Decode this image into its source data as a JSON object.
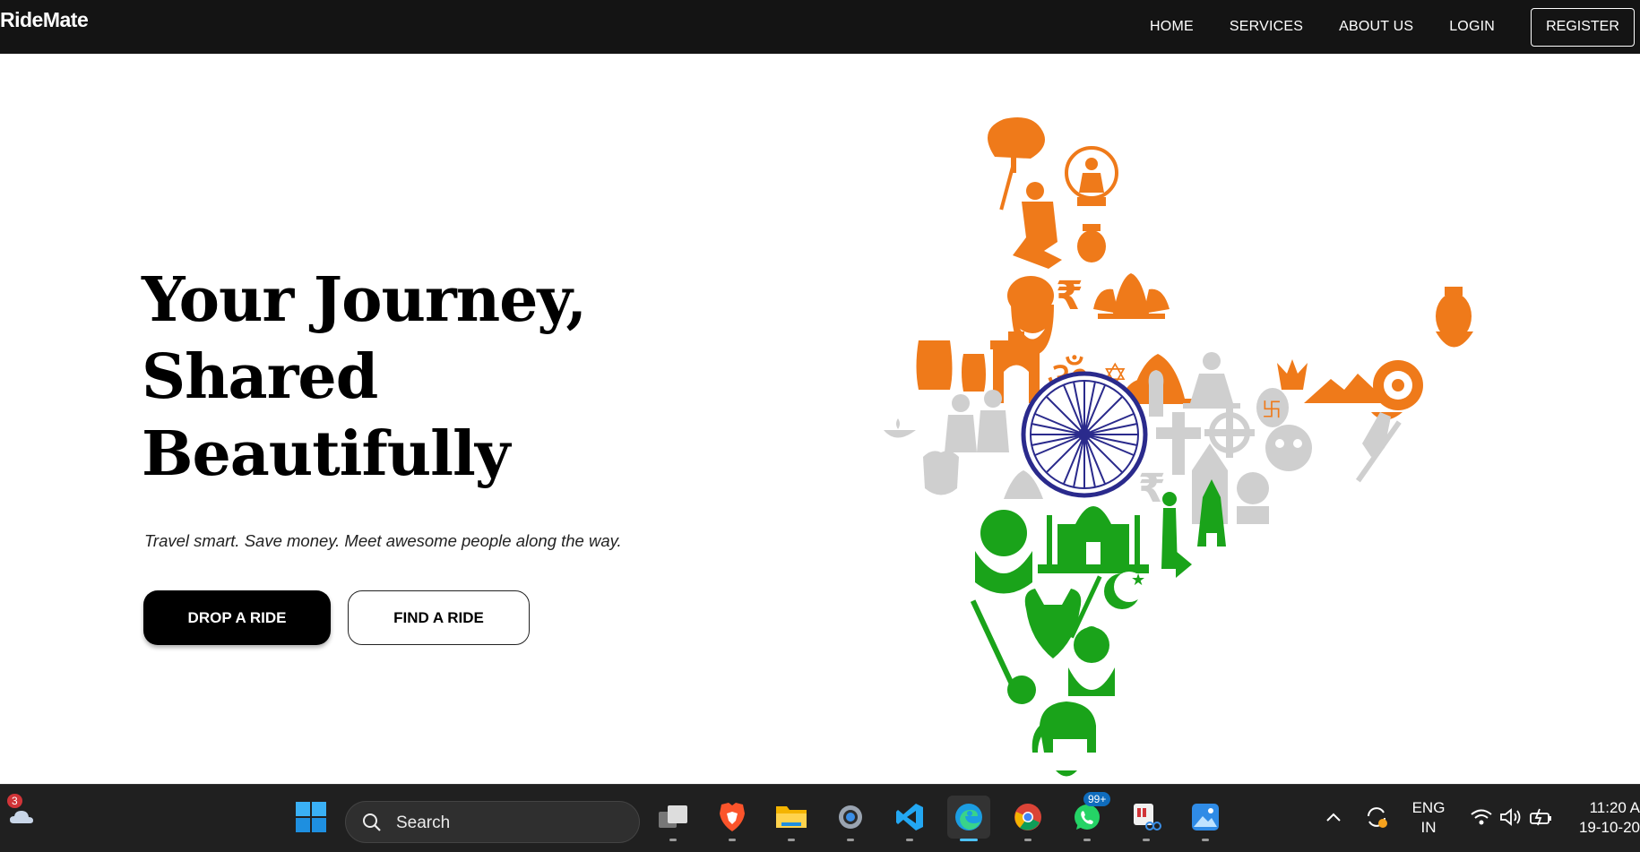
{
  "nav": {
    "brand": "RideMate",
    "links": [
      "HOME",
      "SERVICES",
      "ABOUT US",
      "LOGIN"
    ],
    "register": "REGISTER"
  },
  "hero": {
    "title_lines": [
      "Your Journey,",
      "Shared",
      "Beautifully"
    ],
    "subtitle": "Travel smart. Save money. Meet awesome people along the way.",
    "primary_button": "DROP A RIDE",
    "secondary_button": "FIND A RIDE"
  },
  "colors": {
    "saffron": "#ef7a1a",
    "green": "#1aa31a",
    "grey": "#cfcfcf",
    "chakra_blue": "#2a2a8c",
    "navbar_bg": "#141414"
  },
  "taskbar": {
    "weather_badge": "3",
    "search_placeholder": "Search",
    "whatsapp_badge": "99+",
    "icons": [
      "start-icon",
      "task-view-icon",
      "brave-icon",
      "file-explorer-icon",
      "settings-icon",
      "vscode-icon",
      "edge-icon",
      "chrome-icon",
      "whatsapp-icon",
      "snipping-tool-icon",
      "photos-icon"
    ],
    "language_line1": "ENG",
    "language_line2": "IN",
    "time": "11:20 A",
    "date": "19-10-20"
  }
}
